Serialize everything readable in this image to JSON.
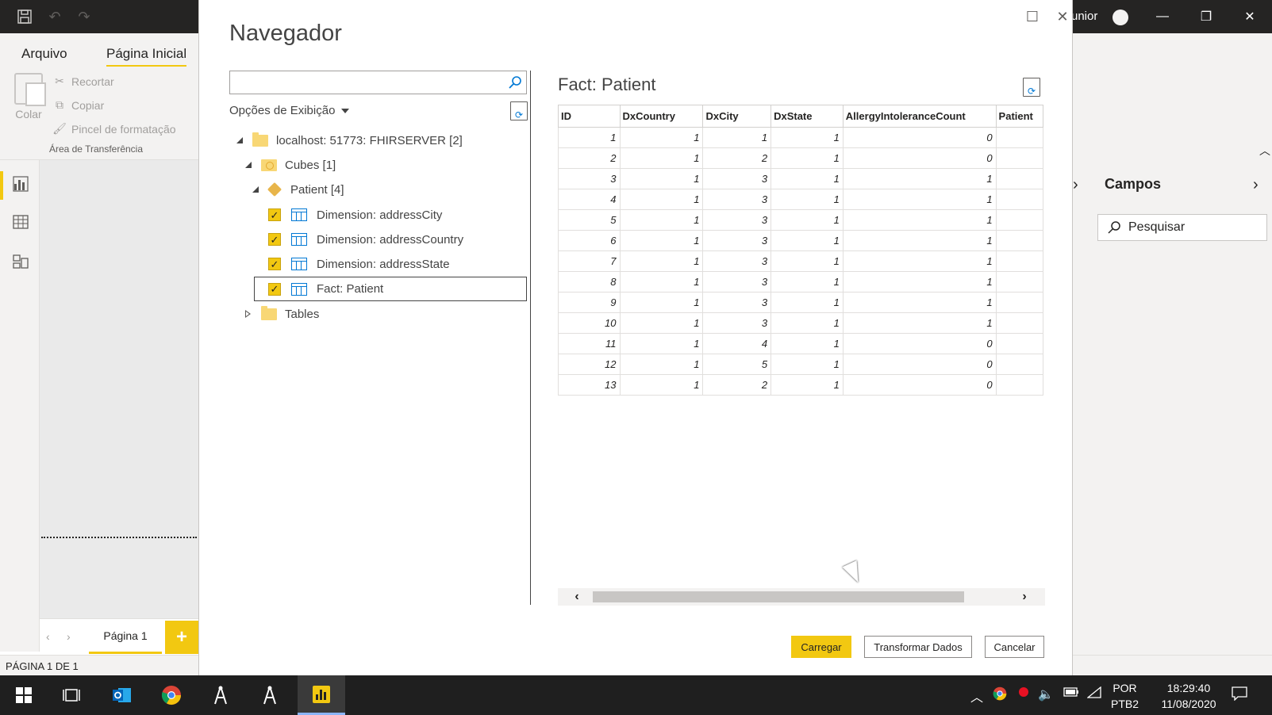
{
  "app": {
    "user_partial": "unior",
    "tabs": {
      "file": "Arquivo",
      "home": "Página Inicial"
    },
    "clipboard": {
      "paste": "Colar",
      "cut": "Recortar",
      "copy": "Copiar",
      "format_painter": "Pincel de formatação",
      "group_label": "Área de Transferência"
    },
    "page_tab": "Página 1",
    "status": "PÁGINA 1 DE 1",
    "fields_pane": {
      "title": "Campos",
      "search_placeholder": "Pesquisar"
    }
  },
  "navigator": {
    "title": "Navegador",
    "search": {
      "value": "",
      "placeholder": ""
    },
    "display_options": "Opções de Exibição",
    "tree": [
      {
        "label": "localhost: 51773: FHIRSERVER [2]",
        "kind": "server",
        "expanded": true
      },
      {
        "label": "Cubes [1]",
        "kind": "folder",
        "expanded": true
      },
      {
        "label": "Patient [4]",
        "kind": "cube",
        "expanded": true
      },
      {
        "label": "Dimension: addressCity",
        "kind": "table",
        "checked": true
      },
      {
        "label": "Dimension: addressCountry",
        "kind": "table",
        "checked": true
      },
      {
        "label": "Dimension: addressState",
        "kind": "table",
        "checked": true
      },
      {
        "label": "Fact: Patient",
        "kind": "table",
        "checked": true,
        "selected": true
      },
      {
        "label": "Tables",
        "kind": "folder",
        "expanded": false
      }
    ],
    "preview": {
      "title": "Fact: Patient",
      "columns": [
        "ID",
        "DxCountry",
        "DxCity",
        "DxState",
        "AllergyIntoleranceCount",
        "Patient"
      ],
      "rows": [
        [
          "1",
          "1",
          "1",
          "1",
          "0",
          ""
        ],
        [
          "2",
          "1",
          "2",
          "1",
          "0",
          ""
        ],
        [
          "3",
          "1",
          "3",
          "1",
          "1",
          ""
        ],
        [
          "4",
          "1",
          "3",
          "1",
          "1",
          ""
        ],
        [
          "5",
          "1",
          "3",
          "1",
          "1",
          ""
        ],
        [
          "6",
          "1",
          "3",
          "1",
          "1",
          ""
        ],
        [
          "7",
          "1",
          "3",
          "1",
          "1",
          ""
        ],
        [
          "8",
          "1",
          "3",
          "1",
          "1",
          ""
        ],
        [
          "9",
          "1",
          "3",
          "1",
          "1",
          ""
        ],
        [
          "10",
          "1",
          "3",
          "1",
          "1",
          ""
        ],
        [
          "11",
          "1",
          "4",
          "1",
          "0",
          ""
        ],
        [
          "12",
          "1",
          "5",
          "1",
          "0",
          ""
        ],
        [
          "13",
          "1",
          "2",
          "1",
          "0",
          ""
        ]
      ]
    },
    "buttons": {
      "load": "Carregar",
      "transform": "Transformar Dados",
      "cancel": "Cancelar"
    }
  },
  "taskbar": {
    "language": "POR",
    "layout": "PTB2",
    "time": "18:29:40",
    "date": "11/08/2020"
  },
  "colors": {
    "accent": "#f2c811",
    "link_blue": "#0078d4",
    "titlebar": "#252423"
  }
}
